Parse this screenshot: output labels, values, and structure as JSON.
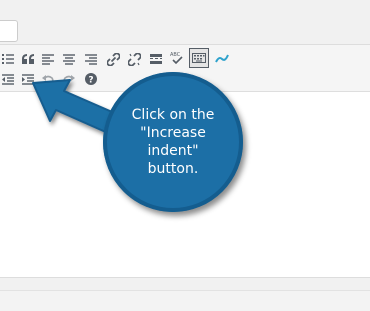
{
  "toolbar": {
    "row1": [
      {
        "icon": "numbered-list-icon",
        "glyph": "⁝≡"
      },
      {
        "icon": "blockquote-icon",
        "glyph": "❝"
      },
      {
        "icon": "align-left-icon",
        "glyph": "≡"
      },
      {
        "icon": "align-center-icon",
        "glyph": "≡"
      },
      {
        "icon": "align-right-icon",
        "glyph": "≡"
      },
      {
        "icon": "insert-link-icon",
        "glyph": "🔗"
      },
      {
        "icon": "remove-link-icon",
        "glyph": "⛓"
      },
      {
        "icon": "read-more-icon",
        "glyph": "▬"
      },
      {
        "icon": "spellcheck-icon",
        "glyph": "ABC"
      },
      {
        "icon": "keyboard-shortcuts-icon",
        "glyph": "⌨"
      },
      {
        "icon": "distraction-free-icon",
        "glyph": "✎"
      }
    ],
    "row2": [
      {
        "icon": "outdent-icon",
        "glyph": "⇤"
      },
      {
        "icon": "indent-icon",
        "glyph": "⇥"
      },
      {
        "icon": "undo-icon",
        "glyph": "↶"
      },
      {
        "icon": "redo-icon",
        "glyph": "↷"
      },
      {
        "icon": "help-icon",
        "glyph": "?"
      }
    ]
  },
  "callout": {
    "text": "Click on the\n\"Increase indent\"\nbutton.",
    "color": "#1c6fa6"
  }
}
